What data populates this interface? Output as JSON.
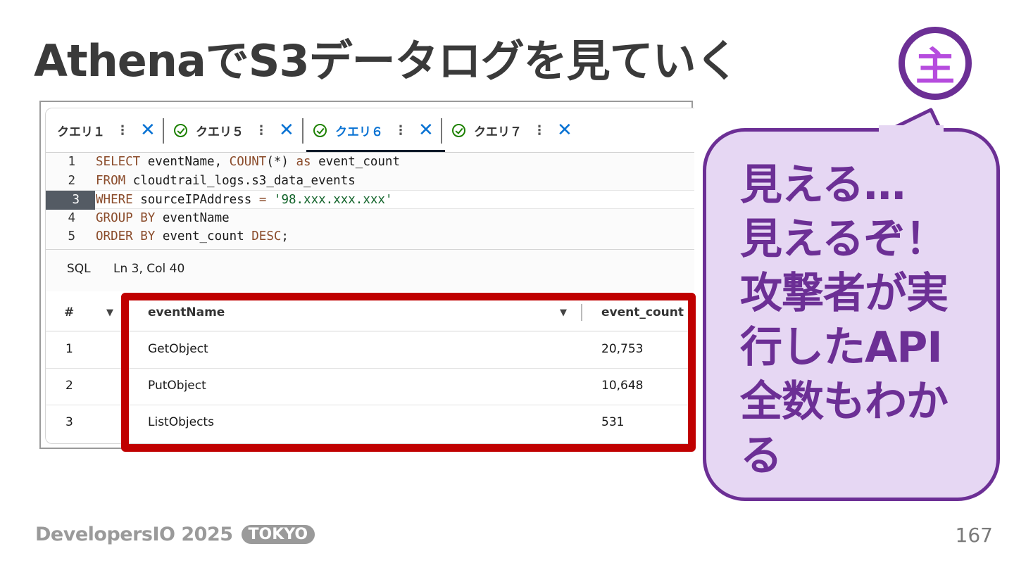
{
  "slide": {
    "title": "AthenaでS3データログを見ていく",
    "badge_char": "主",
    "bubble_text": "見える…\n見えるぞ！\n攻撃者が実\n行したAPI\n全数もわか\nる",
    "footer_brand": "DevelopersIO 2025",
    "footer_tag": "TOKYO",
    "page_number": "167"
  },
  "console": {
    "tabs": [
      {
        "label": "クエリ１",
        "status": "none"
      },
      {
        "label": "クエリ５",
        "status": "success"
      },
      {
        "label": "クエリ６",
        "status": "success",
        "active": true
      },
      {
        "label": "クエリ７",
        "status": "success"
      }
    ],
    "tab_menu_glyph": "⋮",
    "tab_close_glyph": "✕",
    "editor": {
      "lines": [
        {
          "n": "1",
          "tokens": [
            {
              "t": "SELECT",
              "c": "kw"
            },
            {
              "t": " eventName, ",
              "c": "plain"
            },
            {
              "t": "COUNT",
              "c": "fn"
            },
            {
              "t": "(*) ",
              "c": "plain"
            },
            {
              "t": "as",
              "c": "kw"
            },
            {
              "t": " event_count",
              "c": "plain"
            }
          ]
        },
        {
          "n": "2",
          "tokens": [
            {
              "t": "FROM",
              "c": "kw"
            },
            {
              "t": " cloudtrail_logs.s3_data_events",
              "c": "plain"
            }
          ]
        },
        {
          "n": "3",
          "tokens": [
            {
              "t": "WHERE",
              "c": "kw"
            },
            {
              "t": " sourceIPAddress ",
              "c": "plain"
            },
            {
              "t": "=",
              "c": "op"
            },
            {
              "t": " ",
              "c": "plain"
            },
            {
              "t": "'98.xxx.xxx.xxx'",
              "c": "str"
            }
          ],
          "current": true
        },
        {
          "n": "4",
          "tokens": [
            {
              "t": "GROUP BY",
              "c": "kw"
            },
            {
              "t": " eventName",
              "c": "plain"
            }
          ]
        },
        {
          "n": "5",
          "tokens": [
            {
              "t": "ORDER BY",
              "c": "kw"
            },
            {
              "t": " event_count ",
              "c": "plain"
            },
            {
              "t": "DESC",
              "c": "kw"
            },
            {
              "t": ";",
              "c": "plain"
            }
          ]
        }
      ],
      "language": "SQL",
      "cursor_position": "Ln 3, Col 40"
    },
    "results": {
      "columns": [
        "#",
        "eventName",
        "event_count"
      ],
      "sort_glyph": "▼",
      "rows": [
        {
          "idx": "1",
          "eventName": "GetObject",
          "event_count": "20,753"
        },
        {
          "idx": "2",
          "eventName": "PutObject",
          "event_count": "10,648"
        },
        {
          "idx": "3",
          "eventName": "ListObjects",
          "event_count": "531"
        }
      ]
    }
  },
  "colors": {
    "accent_purple": "#6c2f95",
    "bubble_fill": "#e6d7f3",
    "highlight_red": "#c00000",
    "link_blue": "#0972d3",
    "success_green": "#1d8102"
  }
}
